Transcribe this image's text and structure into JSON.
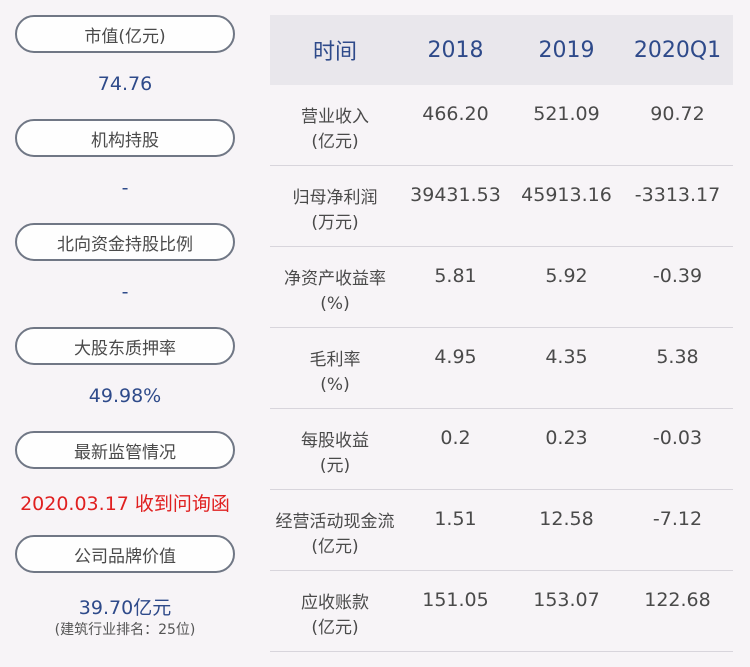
{
  "left_panel": {
    "market_cap": {
      "label": "市值(亿元)",
      "value": "74.76"
    },
    "institutional": {
      "label": "机构持股",
      "value": "-"
    },
    "northbound": {
      "label": "北向资金持股比例",
      "value": "-"
    },
    "pledge": {
      "label": "大股东质押率",
      "value": "49.98%"
    },
    "supervision": {
      "label": "最新监管情况",
      "value": "2020.03.17 收到问询函"
    },
    "brand": {
      "label": "公司品牌价值",
      "value": "39.70亿元",
      "note": "(建筑行业排名：25位)"
    }
  },
  "table": {
    "headers": [
      "时间",
      "2018",
      "2019",
      "2020Q1"
    ],
    "rows": [
      {
        "label1": "营业收入",
        "label2": "(亿元)",
        "v2018": "466.20",
        "v2019": "521.09",
        "v2020q1": "90.72"
      },
      {
        "label1": "归母净利润",
        "label2": "(万元)",
        "v2018": "39431.53",
        "v2019": "45913.16",
        "v2020q1": "-3313.17"
      },
      {
        "label1": "净资产收益率",
        "label2": "(%)",
        "v2018": "5.81",
        "v2019": "5.92",
        "v2020q1": "-0.39"
      },
      {
        "label1": "毛利率",
        "label2": "(%)",
        "v2018": "4.95",
        "v2019": "4.35",
        "v2020q1": "5.38"
      },
      {
        "label1": "每股收益",
        "label2": "(元)",
        "v2018": "0.2",
        "v2019": "0.23",
        "v2020q1": "-0.03"
      },
      {
        "label1": "经营活动现金流",
        "label2": "(亿元)",
        "v2018": "1.51",
        "v2019": "12.58",
        "v2020q1": "-7.12"
      },
      {
        "label1": "应收账款",
        "label2": "(亿元)",
        "v2018": "151.05",
        "v2019": "153.07",
        "v2020q1": "122.68"
      }
    ]
  },
  "colors": {
    "value_blue": "#2e4a8a",
    "alert_red": "#e02020",
    "header_bg": "#e9e7ec",
    "page_bg": "#f7f4f7"
  }
}
